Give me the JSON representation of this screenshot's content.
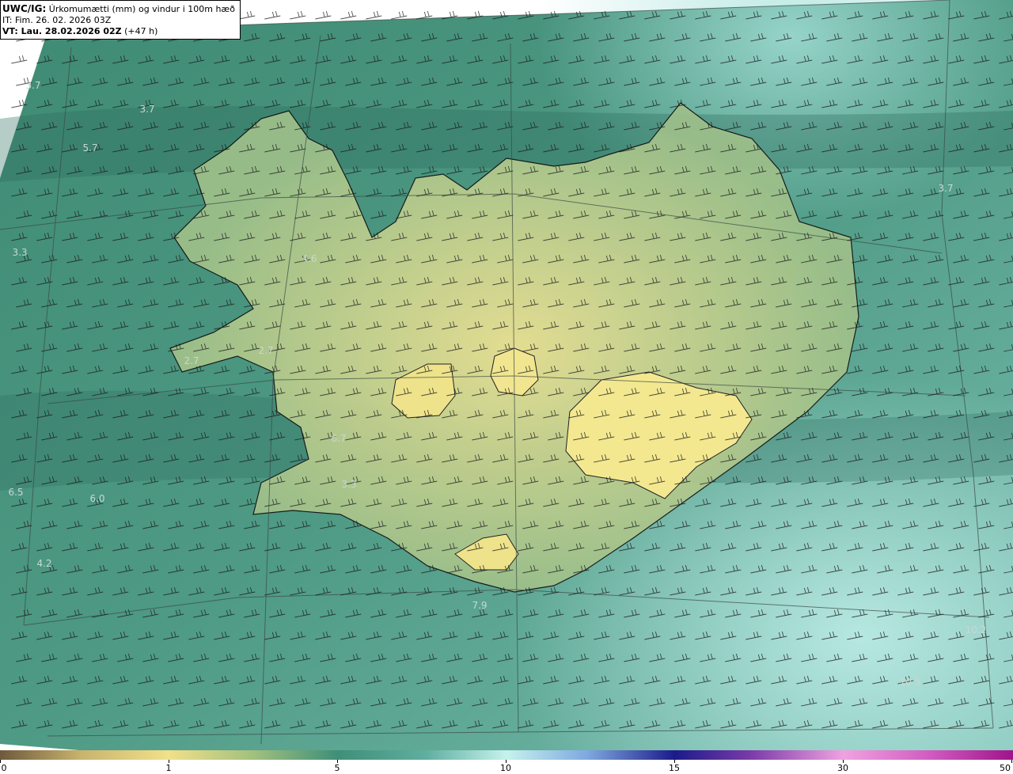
{
  "header": {
    "line1_bold": "UWC/IG:",
    "line1_rest": " Úrkomumætti (mm) og vindur i 100m hæð",
    "line2": "IT: Fim. 26. 02. 2026 03Z",
    "line3_bold": "VT: Lau. 28.02.2026 02Z",
    "line3_rest": " (+47 h)"
  },
  "value_labels": [
    "3.7",
    "3.7",
    "5.7",
    "3.3",
    "4.6",
    "2.7",
    "2.7",
    "6.7",
    "3.3",
    "6.5",
    "6.0",
    "4.2",
    "7.9",
    "10.2",
    "3.7",
    "10.5"
  ],
  "colorbar": {
    "ticks": [
      "0",
      "1",
      "5",
      "10",
      "15",
      "30",
      "50"
    ],
    "segments": [
      "#6e5a3c",
      "#f2e08a",
      "#3f8f79",
      "#c6f2ee",
      "#1c1b8a",
      "#f0a2e0",
      "#a0148a"
    ]
  },
  "colors": {
    "sea_dark": "#2f6f5e",
    "sea_mid": "#4f9a85",
    "land": "#e4dc8e",
    "coast": "#111111"
  }
}
